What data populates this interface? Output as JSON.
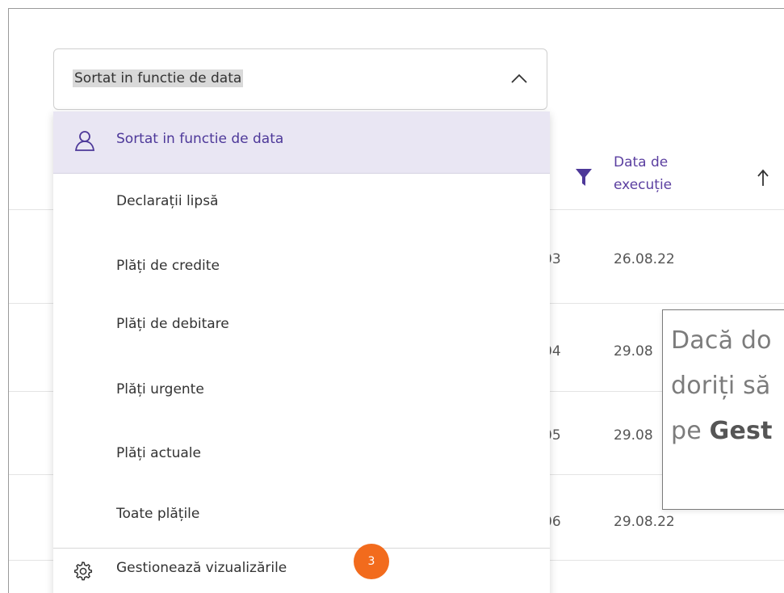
{
  "sort_select": {
    "value": "Sortat in functie de data"
  },
  "menu": {
    "items": [
      {
        "label": "Sortat in functie de data",
        "selected": true,
        "icon": "user-icon"
      },
      {
        "label": "Declarații lipsă"
      },
      {
        "label": "Plăți de credite"
      },
      {
        "label": "Plăți de debitare"
      },
      {
        "label": "Plăți urgente"
      },
      {
        "label": "Plăți actuale"
      },
      {
        "label": "Toate plățile"
      }
    ],
    "manage_label": "Gestionează vizualizările",
    "manage_icon": "gear-icon"
  },
  "badge": {
    "value": "3",
    "color": "#f26b1d"
  },
  "table": {
    "header": {
      "date_line1": "Data de",
      "date_line2": "execuție",
      "filter_icon": "filter-icon",
      "sort_icon": "arrow-up-icon"
    },
    "rows": [
      {
        "id_fragment": "03",
        "date": "26.08.22"
      },
      {
        "id_fragment": "04",
        "date": "29.08"
      },
      {
        "id_fragment": "05",
        "date": "29.08"
      },
      {
        "id_fragment": "06",
        "date": "29.08.22"
      }
    ]
  },
  "tooltip": {
    "line1": "Dacă do",
    "line2": "doriți să",
    "line3_prefix": "pe ",
    "line3_bold": "Gest"
  },
  "colors": {
    "accent": "#5b3fa0",
    "selected_bg": "#e9e6f3",
    "badge": "#f26b1d"
  }
}
